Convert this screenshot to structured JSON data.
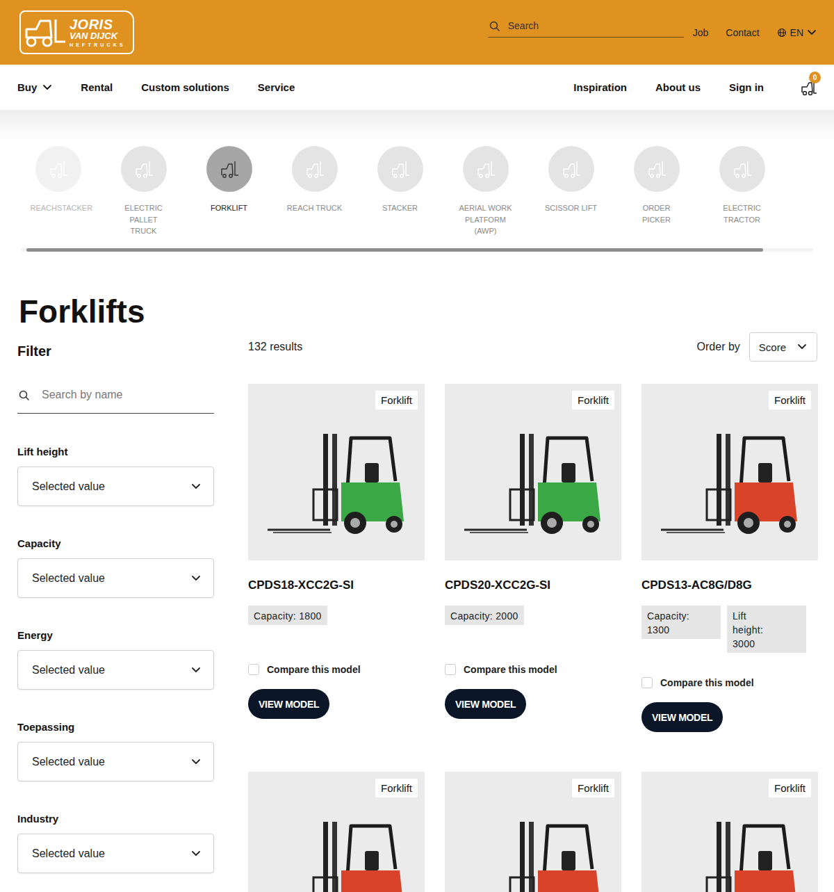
{
  "header": {
    "logo": {
      "line1": "JORIS",
      "line2": "VAN DIJCK",
      "line3": "HEFTRUCKS"
    },
    "search": {
      "placeholder": "Search"
    },
    "links": [
      "Job",
      "Contact"
    ],
    "language": "EN"
  },
  "nav": {
    "left": [
      {
        "label": "Buy",
        "dropdown": true
      },
      {
        "label": "Rental",
        "dropdown": false
      },
      {
        "label": "Custom solutions",
        "dropdown": false
      },
      {
        "label": "Service",
        "dropdown": false
      }
    ],
    "right": [
      "Inspiration",
      "About us",
      "Sign in"
    ],
    "cart_count": "0"
  },
  "categories": [
    {
      "label": "REACHSTACKER",
      "selected": false,
      "faded": true
    },
    {
      "label": "ELECTRIC PALLET TRUCK",
      "selected": false,
      "faded": false
    },
    {
      "label": "FORKLIFT",
      "selected": true,
      "faded": false
    },
    {
      "label": "REACH TRUCK",
      "selected": false,
      "faded": false
    },
    {
      "label": "STACKER",
      "selected": false,
      "faded": false
    },
    {
      "label": "AERIAL WORK PLATFORM (AWP)",
      "selected": false,
      "faded": false
    },
    {
      "label": "SCISSOR LIFT",
      "selected": false,
      "faded": false
    },
    {
      "label": "ORDER PICKER",
      "selected": false,
      "faded": false
    },
    {
      "label": "ELECTRIC TRACTOR",
      "selected": false,
      "faded": false
    }
  ],
  "category_scroll": {
    "level": 0.93
  },
  "title": "Forklifts",
  "filter": {
    "heading": "Filter",
    "search_placeholder": "Search by name",
    "groups": [
      {
        "label": "Lift height",
        "value": "Selected value"
      },
      {
        "label": "Capacity",
        "value": "Selected value"
      },
      {
        "label": "Energy",
        "value": "Selected value"
      },
      {
        "label": "Toepassing",
        "value": "Selected value"
      },
      {
        "label": "Industry",
        "value": "Selected value"
      }
    ]
  },
  "results": {
    "count": "132 results",
    "order_label": "Order by",
    "order_value": "Score"
  },
  "products": [
    {
      "tag": "Forklift",
      "title": "CPDS18-XCC2G-SI",
      "specs": [
        "Capacity: 1800"
      ],
      "compare_label": "Compare this model",
      "compare_checked": false,
      "button": "VIEW MODEL",
      "color": "#3aa845"
    },
    {
      "tag": "Forklift",
      "title": "CPDS20-XCC2G-SI",
      "specs": [
        "Capacity: 2000"
      ],
      "compare_label": "Compare this model",
      "compare_checked": false,
      "button": "VIEW MODEL",
      "color": "#3aa845"
    },
    {
      "tag": "Forklift",
      "title": "CPDS13-AC8G/D8G",
      "specs": [
        "Capacity: 1300",
        "Lift height: 3000"
      ],
      "compare_label": "Compare this model",
      "compare_checked": false,
      "button": "VIEW MODEL",
      "color": "#d9432a"
    },
    {
      "tag": "Forklift",
      "color": "#d9432a"
    },
    {
      "tag": "Forklift",
      "color": "#d9432a"
    },
    {
      "tag": "Forklift",
      "color": "#d9432a"
    }
  ]
}
